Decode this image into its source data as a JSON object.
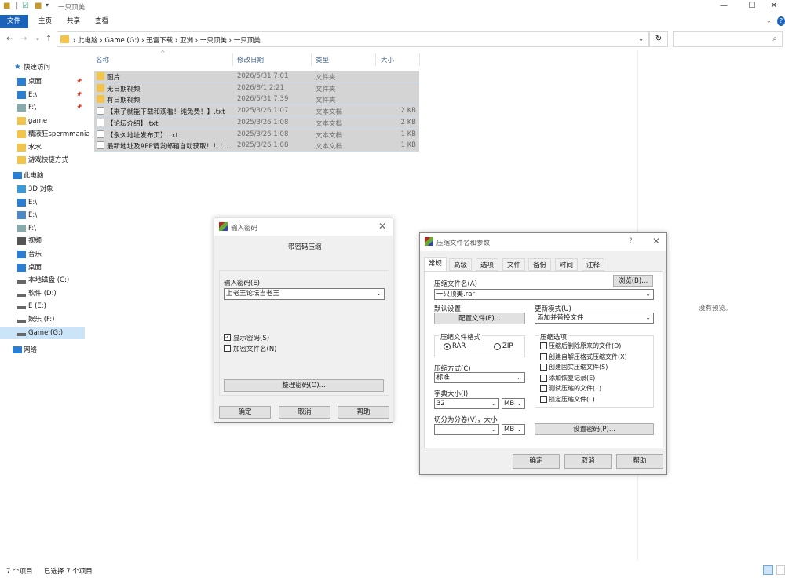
{
  "window": {
    "title": "一只顶美",
    "min": "—",
    "max": "☐",
    "close": "✕"
  },
  "ribbon": {
    "tabs": [
      "文件",
      "主页",
      "共享",
      "查看"
    ]
  },
  "address": {
    "crumbs": "›  此电脑  ›  Game (G:)  ›  迅雷下载  ›  亚洲  ›  一只顶美  ›  一只顶美",
    "refresh_icon": "↻",
    "search_icon": "⌕"
  },
  "nav": {
    "quick_access": "快速访问",
    "items": [
      {
        "label": "桌面",
        "icon": "desktop-icon",
        "pinned": true
      },
      {
        "label": "E:\\",
        "icon": "download-icon",
        "pinned": true
      },
      {
        "label": "F:\\",
        "icon": "doc-icon",
        "pinned": true
      },
      {
        "label": "game",
        "icon": "folder-icon",
        "pinned": false
      },
      {
        "label": "精液狂spermmania",
        "icon": "folder-icon",
        "pinned": false
      },
      {
        "label": "水水",
        "icon": "folder-icon",
        "pinned": false
      },
      {
        "label": "游戏快捷方式",
        "icon": "folder-icon",
        "pinned": false
      }
    ],
    "this_pc": "此电脑",
    "pc_items": [
      {
        "label": "3D 对象",
        "icon": "cube-icon"
      },
      {
        "label": "E:\\",
        "icon": "download-icon"
      },
      {
        "label": "E:\\",
        "icon": "image-icon"
      },
      {
        "label": "F:\\",
        "icon": "doc-icon"
      },
      {
        "label": "视频",
        "icon": "video-icon"
      },
      {
        "label": "音乐",
        "icon": "music-icon"
      },
      {
        "label": "桌面",
        "icon": "desktop-icon"
      },
      {
        "label": "本地磁盘 (C:)",
        "icon": "drive-icon"
      },
      {
        "label": "软件 (D:)",
        "icon": "drive-icon"
      },
      {
        "label": "E (E:)",
        "icon": "drive-icon"
      },
      {
        "label": "娱乐 (F:)",
        "icon": "drive-icon"
      },
      {
        "label": "Game (G:)",
        "icon": "drive-icon"
      }
    ],
    "network": "网络"
  },
  "columns": {
    "name": "名称",
    "date": "修改日期",
    "type": "类型",
    "size": "大小"
  },
  "files": [
    {
      "name": "图片",
      "date": "2026/5/31 7:01",
      "type": "文件夹",
      "size": "",
      "kind": "folder"
    },
    {
      "name": "无日期视频",
      "date": "2026/8/1 2:21",
      "type": "文件夹",
      "size": "",
      "kind": "folder"
    },
    {
      "name": "有日期视频",
      "date": "2026/5/31 7:39",
      "type": "文件夹",
      "size": "",
      "kind": "folder"
    },
    {
      "name": "【来了就能下载和观看！纯免费！】.txt",
      "date": "2025/3/26 1:07",
      "type": "文本文档",
      "size": "2 KB",
      "kind": "txt"
    },
    {
      "name": "【论坛介绍】.txt",
      "date": "2025/3/26 1:08",
      "type": "文本文档",
      "size": "2 KB",
      "kind": "txt"
    },
    {
      "name": "【永久地址发布页】.txt",
      "date": "2025/3/26 1:08",
      "type": "文本文档",
      "size": "1 KB",
      "kind": "txt"
    },
    {
      "name": "最新地址及APP请发邮箱自动获取！！！....",
      "date": "2025/3/26 1:08",
      "type": "文本文档",
      "size": "1 KB",
      "kind": "txt"
    }
  ],
  "preview": {
    "text": "没有预览。"
  },
  "status": {
    "count": "7 个项目",
    "selected": "已选择 7 个项目"
  },
  "pwd_dialog": {
    "title": "输入密码",
    "heading": "带密码压缩",
    "label": "输入密码(E)",
    "value": "上老王论坛当老王",
    "show_pwd": "显示密码(S)",
    "show_pwd_checked": true,
    "encrypt_names": "加密文件名(N)",
    "encrypt_checked": false,
    "organize": "整理密码(O)...",
    "ok": "确定",
    "cancel": "取消",
    "help": "帮助"
  },
  "rar_dialog": {
    "title": "压缩文件名和参数",
    "help_q": "?",
    "tabs": [
      "常规",
      "高级",
      "选项",
      "文件",
      "备份",
      "时间",
      "注释"
    ],
    "archive_label": "压缩文件名(A)",
    "browse": "浏览(B)...",
    "archive_value": "一只顶美.rar",
    "default_label": "默认设置",
    "profiles": "配置文件(F)...",
    "update_label": "更新模式(U)",
    "update_value": "添加并替换文件",
    "format_group": "压缩文件格式",
    "fmt_rar": "RAR",
    "fmt_zip": "ZIP",
    "method_label": "压缩方式(C)",
    "method_value": "标准",
    "dict_label": "字典大小(I)",
    "dict_value": "32",
    "dict_unit": "MB",
    "split_label": "切分为分卷(V)，大小",
    "split_value": "",
    "split_unit": "MB",
    "options_group": "压缩选项",
    "options": [
      "压缩后删除原来的文件(D)",
      "创建自解压格式压缩文件(X)",
      "创建固实压缩文件(S)",
      "添加恢复记录(E)",
      "测试压缩的文件(T)",
      "锁定压缩文件(L)"
    ],
    "set_pwd": "设置密码(P)...",
    "ok": "确定",
    "cancel": "取消",
    "help": "帮助"
  }
}
